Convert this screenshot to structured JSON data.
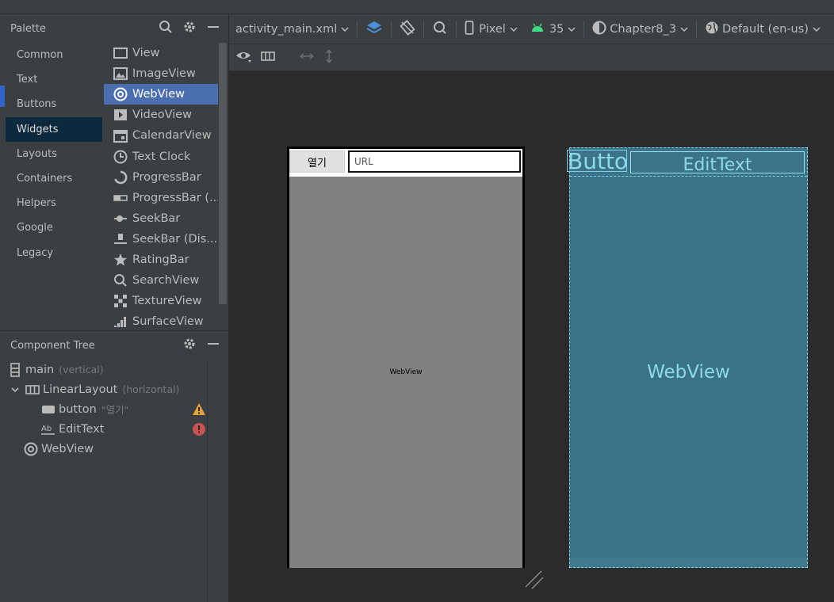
{
  "palette": {
    "title": "Palette",
    "categories": [
      "Common",
      "Text",
      "Buttons",
      "Widgets",
      "Layouts",
      "Containers",
      "Helpers",
      "Google",
      "Legacy"
    ],
    "selected_category": "Widgets",
    "widgets": [
      {
        "label": "View",
        "icon": "view-icon"
      },
      {
        "label": "ImageView",
        "icon": "image-icon"
      },
      {
        "label": "WebView",
        "icon": "chrome-icon"
      },
      {
        "label": "VideoView",
        "icon": "play-icon"
      },
      {
        "label": "CalendarView",
        "icon": "calendar-icon"
      },
      {
        "label": "Text Clock",
        "icon": "clock-icon"
      },
      {
        "label": "ProgressBar",
        "icon": "progress-circle-icon"
      },
      {
        "label": "ProgressBar (...",
        "icon": "progress-bar-icon"
      },
      {
        "label": "SeekBar",
        "icon": "seekbar-icon"
      },
      {
        "label": "SeekBar (Dis...",
        "icon": "seekbar-discrete-icon"
      },
      {
        "label": "RatingBar",
        "icon": "star-icon"
      },
      {
        "label": "SearchView",
        "icon": "search-icon"
      },
      {
        "label": "TextureView",
        "icon": "texture-icon"
      },
      {
        "label": "SurfaceView",
        "icon": "surface-icon"
      }
    ],
    "selected_widget": "WebView"
  },
  "component_tree": {
    "title": "Component Tree",
    "nodes": [
      {
        "label": "main",
        "sub": "(vertical)"
      },
      {
        "label": "LinearLayout",
        "sub": "(horizontal)"
      },
      {
        "label": "button",
        "sub": "\"열기\"",
        "status": "warning"
      },
      {
        "label": "EditText",
        "sub": "",
        "status": "error"
      },
      {
        "label": "WebView",
        "sub": ""
      }
    ]
  },
  "toolbar": {
    "file": "activity_main.xml",
    "device": "Pixel",
    "api": "35",
    "theme": "Chapter8_3",
    "locale": "Default (en-us)"
  },
  "design": {
    "button_label": "열기",
    "edit_placeholder": "URL",
    "webview_label": "WebView"
  },
  "blueprint": {
    "button_label": "Button",
    "edit_label": "EditText",
    "webview_label": "WebView"
  },
  "colors": {
    "accent": "#4b6eaf",
    "blueprint": "#3a7387",
    "warning": "#e2a33a",
    "error": "#c75450"
  }
}
